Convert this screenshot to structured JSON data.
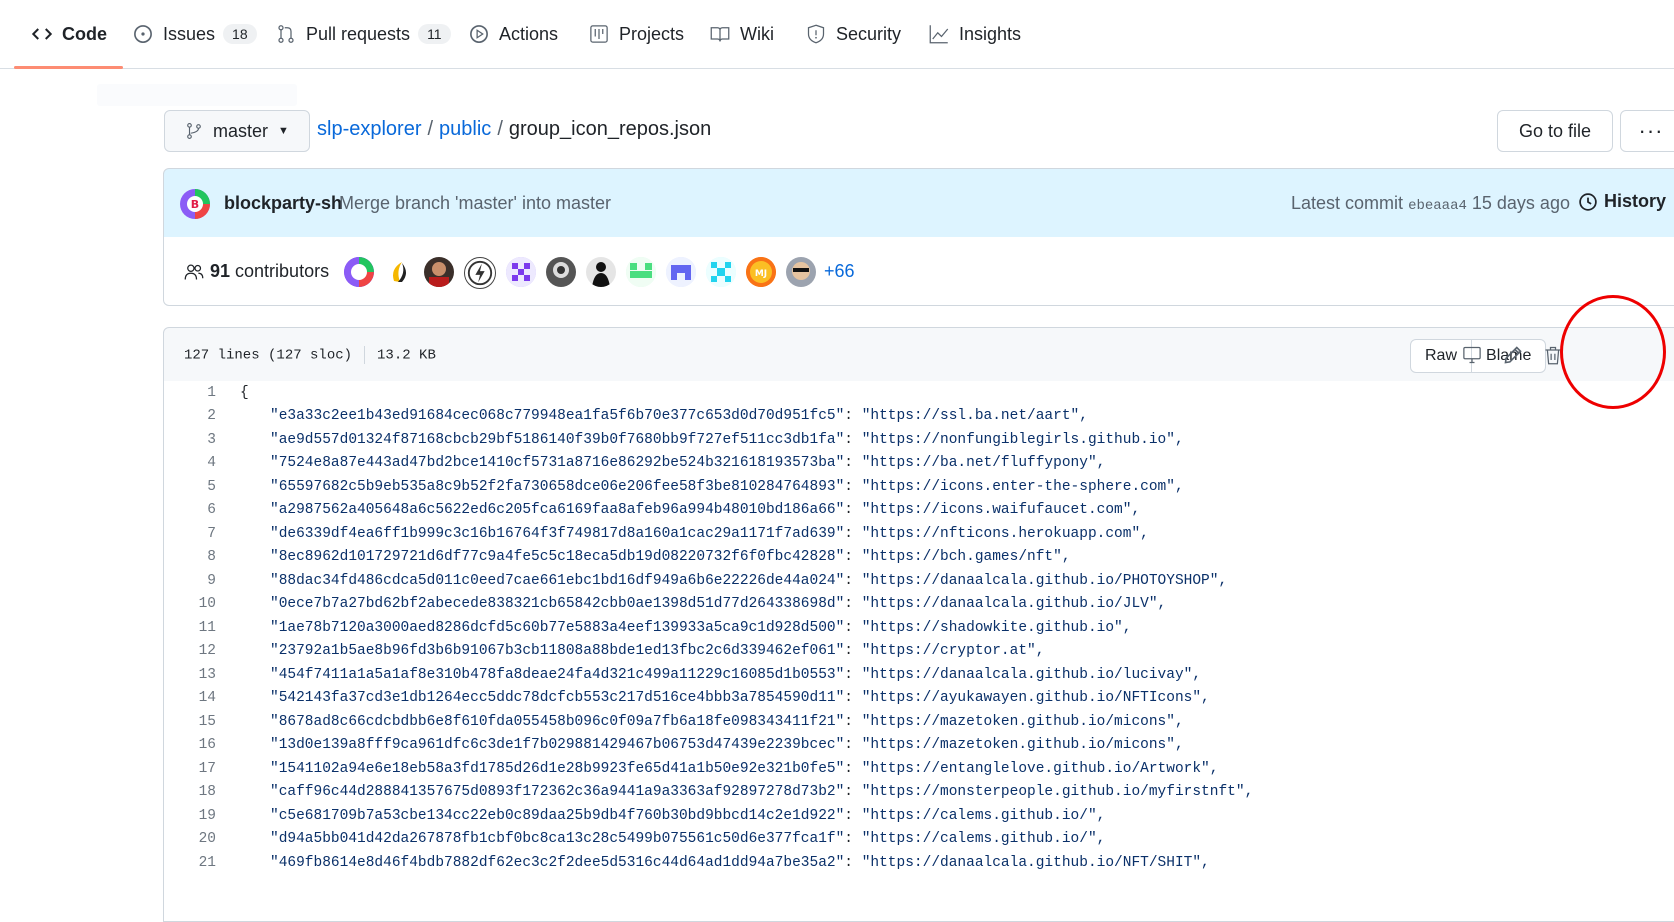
{
  "nav": {
    "tabs": [
      {
        "label": "Code",
        "icon": "code-icon",
        "selected": true
      },
      {
        "label": "Issues",
        "icon": "issue-icon",
        "count": "18"
      },
      {
        "label": "Pull requests",
        "icon": "pull-request-icon",
        "count": "11"
      },
      {
        "label": "Actions",
        "icon": "play-icon"
      },
      {
        "label": "Projects",
        "icon": "project-icon"
      },
      {
        "label": "Wiki",
        "icon": "book-icon"
      },
      {
        "label": "Security",
        "icon": "shield-icon"
      },
      {
        "label": "Insights",
        "icon": "graph-icon"
      }
    ],
    "accent_color": "#fd8c73"
  },
  "branch": {
    "name": "master"
  },
  "breadcrumb": {
    "repo": "slp-explorer",
    "folder": "public",
    "file": "group_icon_repos.json",
    "separator": "/"
  },
  "actions": {
    "go_to_file": "Go to file",
    "more": "···"
  },
  "commit": {
    "author": "blockparty-sh",
    "message": "Merge branch 'master' into master",
    "latest_label": "Latest commit",
    "sha": "ebeaaa4",
    "time": "15 days ago",
    "history_label": "History",
    "background": "#ddf4ff"
  },
  "contributors": {
    "count": "91",
    "label": "contributors",
    "more": "+66"
  },
  "file": {
    "lines_info": "127 lines (127 sloc)",
    "size": "13.2 KB",
    "raw_label": "Raw",
    "blame_label": "Blame"
  },
  "code": [
    {
      "n": "1",
      "key": "",
      "val": "",
      "raw": "{"
    },
    {
      "n": "2",
      "key": "\"e3a33c2ee1b43ed91684cec068c779948ea1fa5f6b70e377c653d0d70d951fc5\"",
      "val": "\"https://ssl.ba.net/aart\","
    },
    {
      "n": "3",
      "key": "\"ae9d557d01324f87168cbcb29bf5186140f39b0f7680bb9f727ef511cc3db1fa\"",
      "val": "\"https://nonfungiblegirls.github.io\","
    },
    {
      "n": "4",
      "key": "\"7524e8a87e443ad47bd2bce1410cf5731a8716e86292be524b321618193573ba\"",
      "val": "\"https://ba.net/fluffypony\","
    },
    {
      "n": "5",
      "key": "\"65597682c5b9eb535a8c9b52f2fa730658dce06e206fee58f3be810284764893\"",
      "val": "\"https://icons.enter-the-sphere.com\","
    },
    {
      "n": "6",
      "key": "\"a2987562a405648a6c5622ed6c205fca6169faa8afeb96a994b48010bd186a66\"",
      "val": "\"https://icons.waifufaucet.com\","
    },
    {
      "n": "7",
      "key": "\"de6339df4ea6ff1b999c3c16b16764f3f749817d8a160a1cac29a1171f7ad639\"",
      "val": "\"https://nfticons.herokuapp.com\","
    },
    {
      "n": "8",
      "key": "\"8ec8962d101729721d6df77c9a4fe5c5c18eca5db19d08220732f6f0fbc42828\"",
      "val": "\"https://bch.games/nft\","
    },
    {
      "n": "9",
      "key": "\"88dac34fd486cdca5d011c0eed7cae661ebc1bd16df949a6b6e22226de44a024\"",
      "val": "\"https://danaalcala.github.io/PHOTOYSHOP\","
    },
    {
      "n": "10",
      "key": "\"0ece7b7a27bd62bf2abecede838321cb65842cbb0ae1398d51d77d264338698d\"",
      "val": "\"https://danaalcala.github.io/JLV\","
    },
    {
      "n": "11",
      "key": "\"1ae78b7120a3000aed8286dcfd5c60b77e5883a4eef139933a5ca9c1d928d500\"",
      "val": "\"https://shadowkite.github.io\","
    },
    {
      "n": "12",
      "key": "\"23792a1b5ae8b96fd3b6b91067b3cb11808a88bde1ed13fbc2c6d339462ef061\"",
      "val": "\"https://cryptor.at\","
    },
    {
      "n": "13",
      "key": "\"454f7411a1a5a1af8e310b478fa8deae24fa4d321c499a11229c16085d1b0553\"",
      "val": "\"https://danaalcala.github.io/lucivay\","
    },
    {
      "n": "14",
      "key": "\"542143fa37cd3e1db1264ecc5ddc78dcfcb553c217d516ce4bbb3a7854590d11\"",
      "val": "\"https://ayukawayen.github.io/NFTIcons\","
    },
    {
      "n": "15",
      "key": "\"8678ad8c66cdcbdbb6e8f610fda055458b096c0f09a7fb6a18fe098343411f21\"",
      "val": "\"https://mazetoken.github.io/micons\","
    },
    {
      "n": "16",
      "key": "\"13d0e139a8fff9ca961dfc6c3de1f7b029881429467b06753d47439e2239bcec\"",
      "val": "\"https://mazetoken.github.io/micons\","
    },
    {
      "n": "17",
      "key": "\"1541102a94e6e18eb58a3fd1785d26d1e28b9923fe65d41a1b50e92e321b0fe5\"",
      "val": "\"https://entanglelove.github.io/Artwork\","
    },
    {
      "n": "18",
      "key": "\"caff96c44d288841357675d0893f172362c36a9441a9a3363af92897278d73b2\"",
      "val": "\"https://monsterpeople.github.io/myfirstnft\","
    },
    {
      "n": "19",
      "key": "\"c5e681709b7a53cbe134cc22eb0c89daa25b9db4f760b30bd9bbcd14c2e1d922\"",
      "val": "\"https://calems.github.io/\","
    },
    {
      "n": "20",
      "key": "\"d94a5bb041d42da267878fb1cbf0bc8ca13c28c5499b075561c50d6e377fca1f\"",
      "val": "\"https://calems.github.io/\","
    },
    {
      "n": "21",
      "key": "\"469fb8614e8d46f4bdb7882df62ec3c2f2dee5d5316c44d64ad1dd94a7be35a2\"",
      "val": "\"https://danaalcala.github.io/NFT/SHIT\","
    }
  ],
  "annotation_color": "#e00000"
}
